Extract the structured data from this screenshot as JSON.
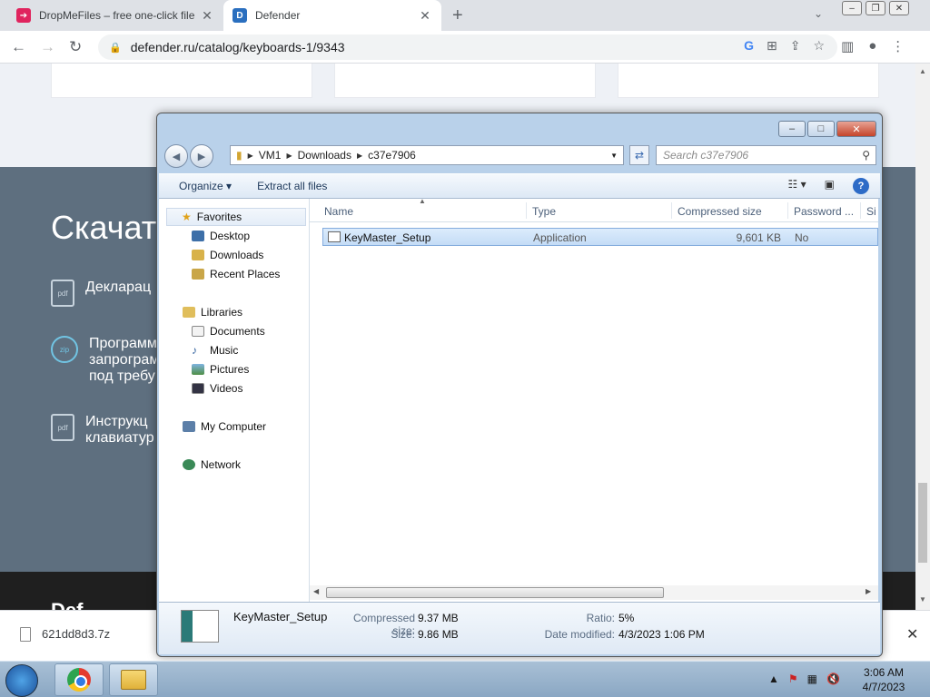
{
  "browser": {
    "tabs": [
      {
        "title": "DropMeFiles – free one-click file",
        "icon": "dropmefiles-icon"
      },
      {
        "title": "Defender",
        "icon": "defender-icon"
      }
    ],
    "url": "defender.ru/catalog/keyboards-1/9343"
  },
  "page": {
    "heading": "Скачат",
    "items": [
      {
        "kind": "pdf",
        "lines": [
          "Декларац"
        ]
      },
      {
        "kind": "zip",
        "lines": [
          "Программ",
          "запрограм",
          "под требу"
        ]
      },
      {
        "kind": "pdf",
        "lines": [
          "Инструкц",
          "клавиатур"
        ]
      }
    ],
    "footer_logo": "Def"
  },
  "downloads_bar": {
    "filename": "621dd8d3.7z"
  },
  "explorer": {
    "path": [
      "VM1",
      "Downloads",
      "c37e7906"
    ],
    "search_placeholder": "Search c37e7906",
    "commands": {
      "organize": "Organize",
      "extract": "Extract all files"
    },
    "nav": {
      "favorites": "Favorites",
      "desktop": "Desktop",
      "downloads": "Downloads",
      "recent": "Recent Places",
      "libraries": "Libraries",
      "documents": "Documents",
      "music": "Music",
      "pictures": "Pictures",
      "videos": "Videos",
      "computer": "My Computer",
      "network": "Network"
    },
    "columns": {
      "name": "Name",
      "type": "Type",
      "compressed": "Compressed size",
      "password": "Password ...",
      "size": "Si"
    },
    "file": {
      "name": "KeyMaster_Setup",
      "type": "Application",
      "compressed": "9,601 KB",
      "password": "No"
    },
    "details": {
      "name": "KeyMaster_Setup",
      "compressed_label": "Compressed size:",
      "compressed_value": "9.37 MB",
      "size_label": "Size:",
      "size_value": "9.86 MB",
      "ratio_label": "Ratio:",
      "ratio_value": "5%",
      "modified_label": "Date modified:",
      "modified_value": "4/3/2023 1:06 PM"
    }
  },
  "taskbar": {
    "time": "3:06 AM",
    "date": "4/7/2023"
  }
}
